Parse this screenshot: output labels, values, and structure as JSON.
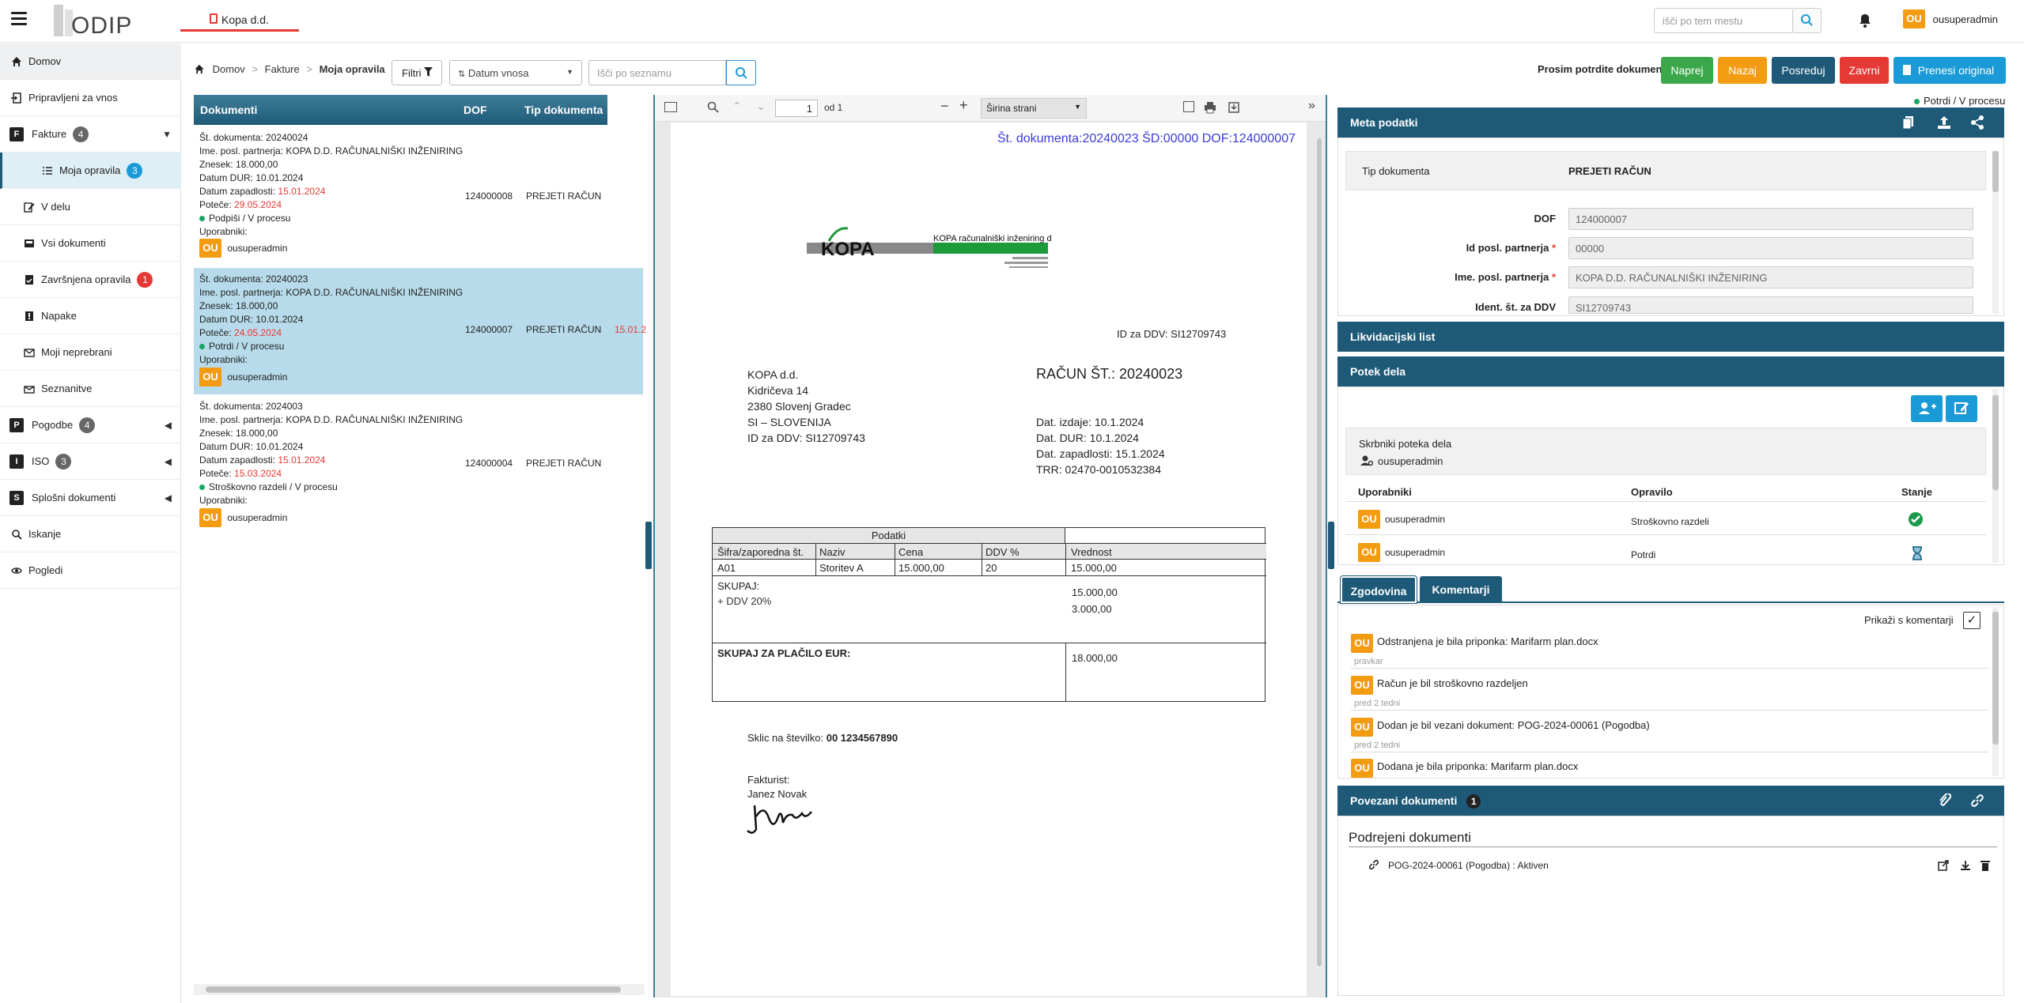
{
  "topbar": {
    "app_tab": "Kopa d.d.",
    "search_placeholder": "išči po tem mestu",
    "user": "ousuperadmin",
    "user_initials": "OU"
  },
  "sidebar": {
    "items": [
      {
        "label": "Domov"
      },
      {
        "label": "Pripravljeni za vnos"
      },
      {
        "label": "Fakture",
        "badge": "4",
        "letter": "F"
      },
      {
        "label": "Moja opravila",
        "badge": "3"
      },
      {
        "label": "V delu"
      },
      {
        "label": "Vsi dokumenti"
      },
      {
        "label": "Završnjena opravila",
        "badge": "1"
      },
      {
        "label": "Napake"
      },
      {
        "label": "Moji neprebrani"
      },
      {
        "label": "Seznanitve"
      },
      {
        "label": "Pogodbe",
        "badge": "4",
        "letter": "P"
      },
      {
        "label": "ISO",
        "badge": "3",
        "letter": "I"
      },
      {
        "label": "Splošni dokumenti",
        "letter": "S"
      },
      {
        "label": "Iskanje"
      },
      {
        "label": "Pogledi"
      }
    ]
  },
  "breadcrumb": {
    "home": "Domov",
    "section": "Fakture",
    "current": "Moja opravila"
  },
  "filters": {
    "filter_label": "Filtri",
    "sort_value": "Datum vnosa",
    "list_search_placeholder": "Išči po seznamu"
  },
  "actions": {
    "prompt": "Prosim potrdite dokument",
    "buttons": [
      "Naprej",
      "Nazaj",
      "Posreduj",
      "Zavrni",
      "Prenesi original"
    ],
    "colors": [
      "#3aa84a",
      "#f39c12",
      "#1e5a78",
      "#e53935",
      "#1a9ad6"
    ]
  },
  "list": {
    "headers": [
      "Dokumenti",
      "DOF",
      "Tip dokumenta"
    ],
    "rows": [
      {
        "lines": [
          "Št. dokumenta: 20240024",
          "Ime. posl. partnerja: KOPA D.D. RAČUNALNIŠKI INŽENIRING",
          "Znesek: 18.000,00",
          "Datum DUR: 10.01.2024"
        ],
        "zapadlost_label": "Datum zapadlosti:",
        "zapadlost": "15.01.2024",
        "poteče_label": "Poteče:",
        "poteče": "29.05.2024",
        "status": "Podpiši / V procesu",
        "users_label": "Uporabniki:",
        "user": "ousuperadmin",
        "dof": "124000008",
        "type": "PREJETI RAČUN"
      },
      {
        "lines": [
          "Št. dokumenta: 20240023",
          "Ime. posl. partnerja: KOPA D.D. RAČUNALNIŠKI INŽENIRING",
          "Znesek: 18.000,00",
          "Datum DUR: 10.01.2024"
        ],
        "poteče_label": "Poteče:",
        "poteče": "24.05.2024",
        "status": "Potrdi / V procesu",
        "users_label": "Uporabniki:",
        "user": "ousuperadmin",
        "dof": "124000007",
        "type": "PREJETI RAČUN",
        "extra": "15.01.2"
      },
      {
        "lines": [
          "Št. dokumenta: 2024003",
          "Ime. posl. partnerja: KOPA D.D. RAČUNALNIŠKI INŽENIRING",
          "Znesek: 18.000,00",
          "Datum DUR: 10.01.2024"
        ],
        "zapadlost_label": "Datum zapadlosti:",
        "zapadlost": "15.01.2024",
        "poteče_label": "Poteče:",
        "poteče": "15.03.2024",
        "status": "Stroškovno razdeli / V procesu",
        "users_label": "Uporabniki:",
        "user": "ousuperadmin",
        "dof": "124000004",
        "type": "PREJETI RAČUN"
      }
    ]
  },
  "pdf": {
    "page_number": "1",
    "page_of": "od 1",
    "zoom": "Širina strani",
    "header_stamp": "Št. dokumenta:20240023 ŠD:00000 DOF:124000007",
    "logo_text": "KOPA",
    "logo_right": "KOPA računalniški inženiring d.d.",
    "id_ddv_top": "ID za DDV: SI12709743",
    "company": [
      "KOPA d.d.",
      "Kidričeva 14",
      "2380 Slovenj Gradec",
      "SI – SLOVENIJA",
      "ID za DDV: SI12709743"
    ],
    "invoice_title": "RAČUN ŠT.: 20240023",
    "dates": [
      "Dat. izdaje: 10.1.2024",
      "Dat. DUR: 10.1.2024",
      "Dat. zapadlosti: 15.1.2024",
      "TRR: 02470-0010532384"
    ],
    "table": {
      "group_header": "Podatki",
      "headers": [
        "Šifra/zaporedna št.",
        "Naziv",
        "Cena",
        "DDV %",
        "Vrednost"
      ],
      "row": [
        "A01",
        "Storitev A",
        "15.000,00",
        "20",
        "15.000,00"
      ],
      "skupaj_label": "SKUPAJ:",
      "ddv_label": "+ DDV 20%",
      "skupaj_value": "15.000,00",
      "ddv_value": "3.000,00",
      "total_label": "SKUPAJ ZA PLAČILO EUR:",
      "total_value": "18.000,00"
    },
    "sklic_label": "Sklic na številko:",
    "sklic_value": "00 1234567890",
    "fakturist_label": "Fakturist:",
    "fakturist": "Janez Novak"
  },
  "meta": {
    "status": "Potrdi / V procesu",
    "title": "Meta podatki",
    "doc_type_label": "Tip dokumenta",
    "doc_type": "PREJETI RAČUN",
    "fields": [
      {
        "label": "DOF",
        "value": "124000007",
        "required": false
      },
      {
        "label": "Id posl. partnerja",
        "value": "00000",
        "required": true
      },
      {
        "label": "Ime. posl. partnerja",
        "value": "KOPA D.D.  RAČUNALNIŠKI INŽENIRING",
        "required": true
      },
      {
        "label": "Ident. št. za DDV",
        "value": "SI12709743",
        "required": false
      }
    ]
  },
  "likvidacijski": {
    "title": "Likvidacijski list"
  },
  "workflow": {
    "title": "Potek dela",
    "guardians_label": "Skrbniki poteka dela",
    "guardian": "ousuperadmin",
    "headers": [
      "Uporabniki",
      "Opravilo",
      "Stanje"
    ],
    "rows": [
      {
        "user": "ousuperadmin",
        "task": "Stroškovno razdeli",
        "state": "done"
      },
      {
        "user": "ousuperadmin",
        "task": "Potrdi",
        "state": "pending"
      }
    ]
  },
  "history": {
    "tabs": [
      "Zgodovina",
      "Komentarji"
    ],
    "show_comments_label": "Prikaži s komentarji",
    "items": [
      {
        "text": "Odstranjena je bila priponka: Marifarm plan.docx",
        "time": "pravkar"
      },
      {
        "text": "Račun je bil stroškovno razdeljen",
        "time": "pred 2 tedni"
      },
      {
        "text": "Dodan je bil vezani dokument: POG-2024-00061 (Pogodba)",
        "time": "pred 2 tedni"
      },
      {
        "text": "Dodana je bila priponka: Marifarm plan.docx",
        "time": ""
      }
    ]
  },
  "linked": {
    "title": "Povezani dokumenti",
    "count": "1",
    "sub_title": "Podrejeni dokumenti",
    "item": "POG-2024-00061 (Pogodba) : Aktiven"
  }
}
